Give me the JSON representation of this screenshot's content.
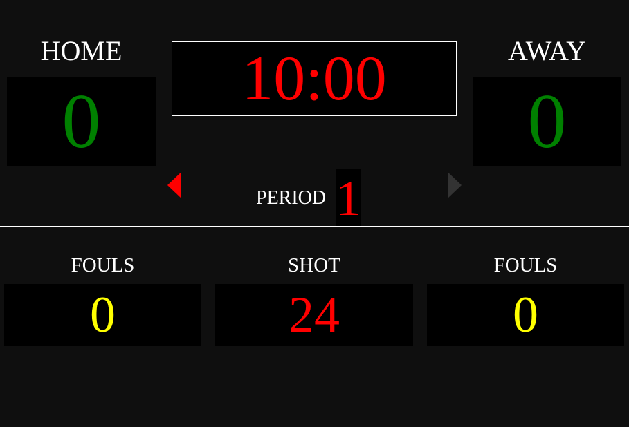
{
  "home": {
    "label": "HOME",
    "score": "0"
  },
  "away": {
    "label": "AWAY",
    "score": "0"
  },
  "clock": {
    "time": "10:00"
  },
  "period": {
    "label": "PERIOD",
    "value": "1",
    "prev_icon": "caret-left-icon",
    "next_icon": "caret-right-icon"
  },
  "stats": {
    "home_fouls": {
      "label": "FOULS",
      "value": "0"
    },
    "shot_clock": {
      "label": "SHOT",
      "value": "24"
    },
    "away_fouls": {
      "label": "FOULS",
      "value": "0"
    }
  },
  "colors": {
    "score": "#008000",
    "clock": "#ff0000",
    "period": "#ff0000",
    "fouls": "#ffff00",
    "shot": "#ff0000",
    "arrow_active": "#ff0000",
    "arrow_inactive": "#333333"
  }
}
